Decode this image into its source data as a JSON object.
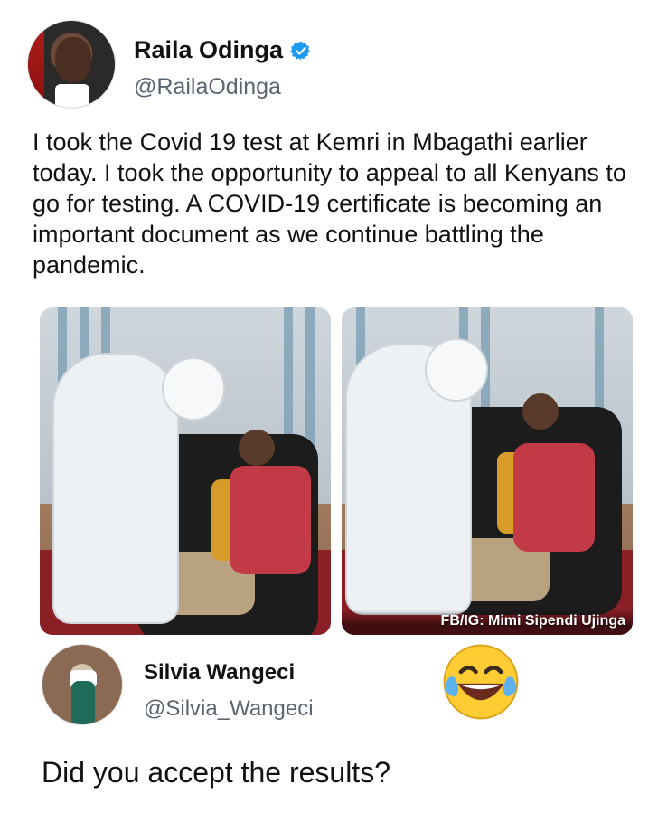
{
  "tweet": {
    "author": {
      "display_name": "Raila Odinga",
      "handle": "@RailaOdinga",
      "verified": true,
      "avatar_icon": "person-avatar-icon"
    },
    "text": "I took the Covid 19 test at Kemri in Mbagathi earlier today. I took the opportunity to appeal to all Kenyans to go for testing. A COVID-19 certificate is becoming an important document as we continue battling the pandemic.",
    "photos": [
      {
        "name": "photo-covid-test-left"
      },
      {
        "name": "photo-covid-test-right",
        "caption": "FB/IG: Mimi Sipendi Ujinga"
      }
    ]
  },
  "reply": {
    "author": {
      "display_name": "Silvia Wangeci",
      "handle": "@Silvia_Wangeci",
      "avatar_icon": "person-avatar-icon"
    },
    "emoji": {
      "icon": "laughing-crying-emoji-icon",
      "face_color": "#ffcc33",
      "tear_color": "#5fb2f2"
    },
    "text": "Did you accept the results?"
  },
  "colors": {
    "verified_badge": "#1d9bf0",
    "handle_text": "#5b6570"
  }
}
